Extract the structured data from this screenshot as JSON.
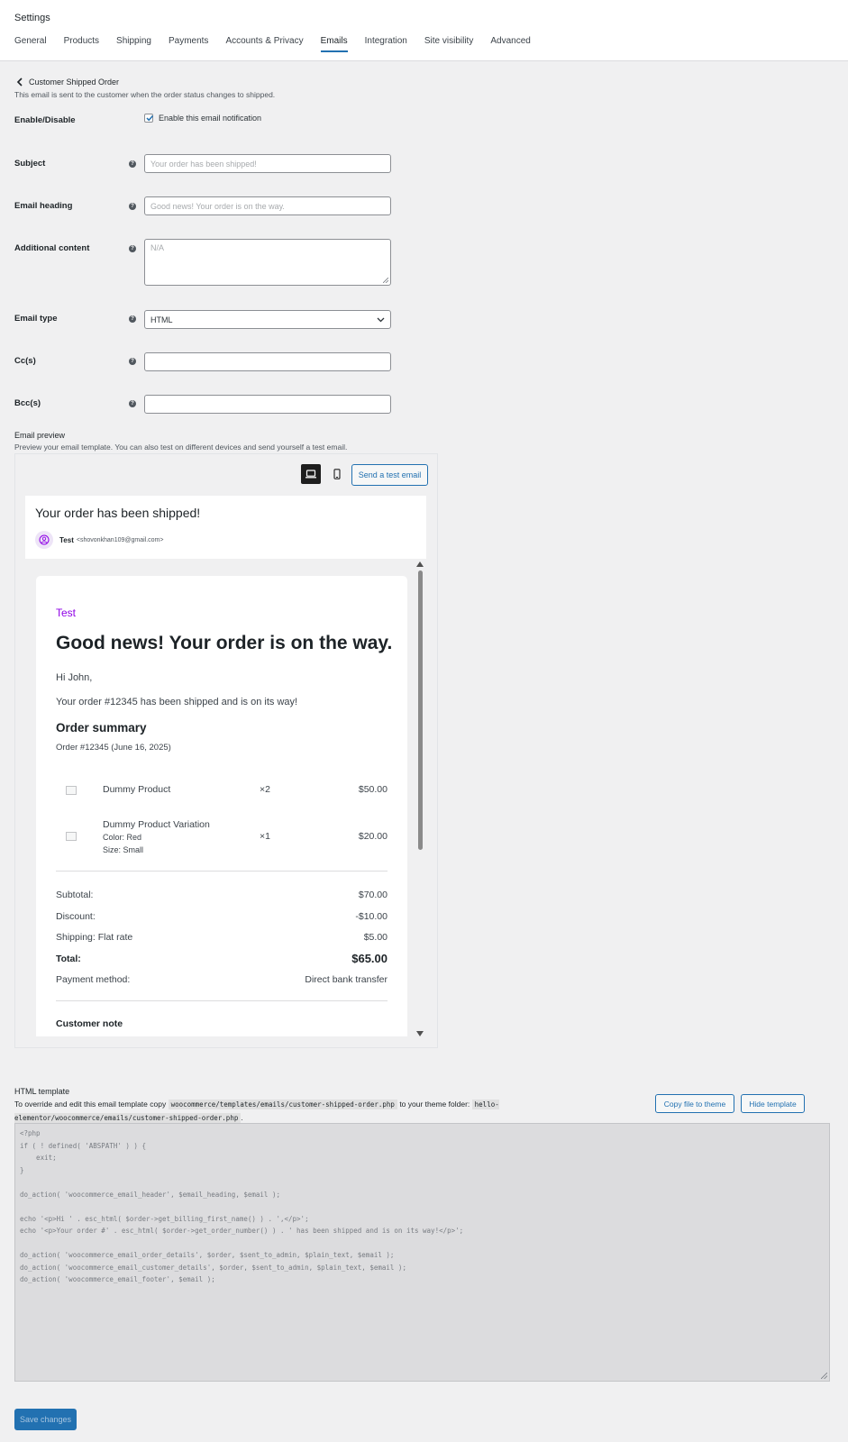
{
  "header": {
    "title": "Settings",
    "tabs": [
      {
        "label": "General"
      },
      {
        "label": "Products"
      },
      {
        "label": "Shipping"
      },
      {
        "label": "Payments"
      },
      {
        "label": "Accounts & Privacy"
      },
      {
        "label": "Emails",
        "active": true
      },
      {
        "label": "Integration"
      },
      {
        "label": "Site visibility"
      },
      {
        "label": "Advanced"
      }
    ]
  },
  "section": {
    "back_label": "Customer Shipped Order",
    "description": "This email is sent to the customer when the order status changes to shipped."
  },
  "form": {
    "enable_label": "Enable/Disable",
    "enable_checkbox_label": "Enable this email notification",
    "enable_checked": true,
    "subject_label": "Subject",
    "subject_placeholder": "Your order has been shipped!",
    "heading_label": "Email heading",
    "heading_placeholder": "Good news! Your order is on the way.",
    "additional_label": "Additional content",
    "additional_placeholder": "N/A",
    "type_label": "Email type",
    "type_value": "HTML",
    "cc_label": "Cc(s)",
    "bcc_label": "Bcc(s)"
  },
  "preview": {
    "title": "Email preview",
    "description": "Preview your email template. You can also test on different devices and send yourself a test email.",
    "send_test_label": "Send a test email",
    "mail_subject": "Your order has been shipped!",
    "from_name": "Test",
    "from_email": "<shovonkhan109@gmail.com>",
    "store_name": "Test",
    "heading": "Good news! Your order is on the way.",
    "greeting": "Hi John,",
    "message": "Your order #12345 has been shipped and is on its way!",
    "summary_title": "Order summary",
    "order_line": "Order #12345 (June 16, 2025)",
    "items": [
      {
        "name": "Dummy Product",
        "qty": "×2",
        "price": "$50.00"
      },
      {
        "name": "Dummy Product Variation",
        "meta1": "Color: Red",
        "meta2": "Size: Small",
        "qty": "×1",
        "price": "$20.00"
      }
    ],
    "totals": {
      "subtotal_label": "Subtotal:",
      "subtotal": "$70.00",
      "discount_label": "Discount:",
      "discount": "-$10.00",
      "shipping_label": "Shipping: Flat rate",
      "shipping": "$5.00",
      "total_label": "Total:",
      "total": "$65.00",
      "payment_label": "Payment method:",
      "payment": "Direct bank transfer"
    },
    "customer_note_title": "Customer note"
  },
  "template": {
    "title": "HTML template",
    "desc_prefix": "To override and edit this email template copy",
    "source_path": "woocommerce/templates/emails/customer-shipped-order.php",
    "desc_middle": "to your theme folder:",
    "theme_path": "hello-elementor/woocommerce/emails/customer-shipped-order.php",
    "desc_suffix": ".",
    "copy_label": "Copy file to theme",
    "hide_label": "Hide template",
    "code_lines": [
      "<?php",
      "if ( ! defined( 'ABSPATH' ) ) {",
      "    exit;",
      "}",
      "",
      "do_action( 'woocommerce_email_header', $email_heading, $email );",
      "",
      "echo '<p>Hi ' . esc_html( $order->get_billing_first_name() ) . ',</p>';",
      "echo '<p>Your order #' . esc_html( $order->get_order_number() ) . ' has been shipped and is on its way!</p>';",
      "",
      "do_action( 'woocommerce_email_order_details', $order, $sent_to_admin, $plain_text, $email );",
      "do_action( 'woocommerce_email_customer_details', $order, $sent_to_admin, $plain_text, $email );",
      "do_action( 'woocommerce_email_footer', $email );"
    ]
  },
  "save_label": "Save changes",
  "colors": {
    "accent": "#2271b1",
    "store": "#8f00e6"
  }
}
